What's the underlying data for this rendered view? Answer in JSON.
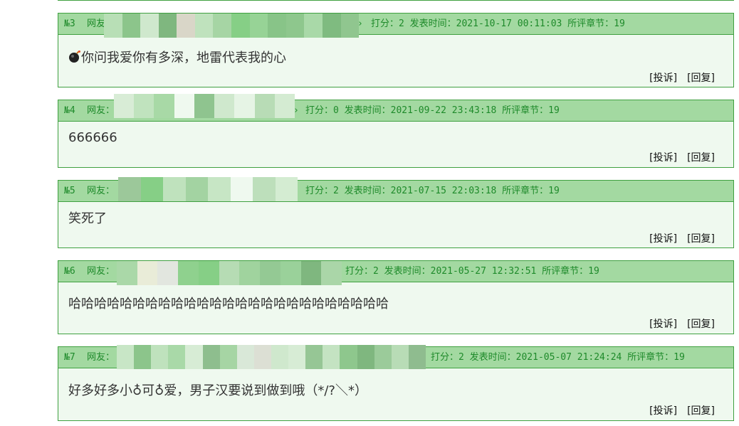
{
  "user_label": "网友：",
  "actions": {
    "report": "[投诉]",
    "reply": "[回复]"
  },
  "comments": [
    {
      "num": "№3",
      "meta": "打分：2 发表时间：2021-10-17 00:11:03 所评章节：19",
      "text": "你问我爱你有多深，地雷代表我的心",
      "icon": "bomb-icon"
    },
    {
      "num": "№4",
      "meta": "打分：0 发表时间：2021-09-22 23:43:18 所评章节：19",
      "text": "666666"
    },
    {
      "num": "№5",
      "meta": "打分：2 发表时间：2021-07-15 22:03:18 所评章节：19",
      "text": "笑死了"
    },
    {
      "num": "№6",
      "meta": "打分：2 发表时间：2021-05-27 12:32:51 所评章节：19",
      "text": "哈哈哈哈哈哈哈哈哈哈哈哈哈哈哈哈哈哈哈哈哈哈哈哈哈"
    },
    {
      "num": "№7",
      "meta": "打分：2 发表时间：2021-05-07 21:24:24 所评章节：19",
      "text": "好多好多小♁可♁爱，男子汉要说到做到哦（*/?＼*）"
    }
  ]
}
